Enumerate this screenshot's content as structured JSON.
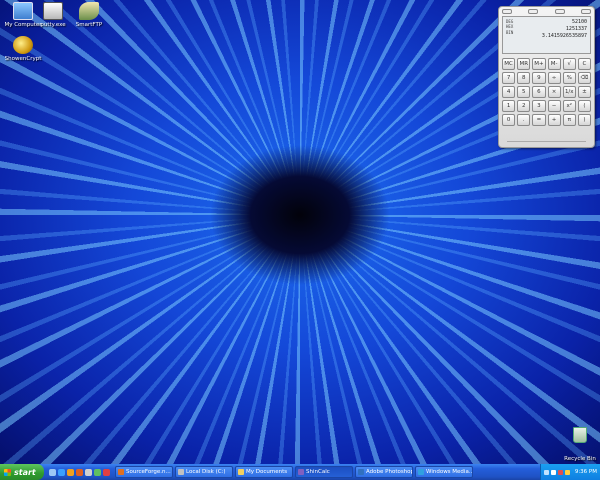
{
  "desktop": {
    "icons": [
      {
        "label": "My Computer",
        "icon": "computer-icon"
      },
      {
        "label": "putty.exe",
        "icon": "terminal-icon"
      },
      {
        "label": "SmartFTP",
        "icon": "ftp-icon"
      },
      {
        "label": "ShowenCrypt",
        "icon": "lock-icon"
      }
    ],
    "recycle_bin": {
      "label": "Recycle Bin",
      "icon": "recycle-bin-icon"
    }
  },
  "calculator": {
    "display_lines": [
      "52100",
      "1251337",
      "3.1415926535897"
    ],
    "mode_labels": [
      "DEG",
      "HEX",
      "BIN"
    ],
    "keys": [
      "MC",
      "MR",
      "M+",
      "M-",
      "√",
      "C",
      "7",
      "8",
      "9",
      "÷",
      "%",
      "⌫",
      "4",
      "5",
      "6",
      "×",
      "1/x",
      "±",
      "1",
      "2",
      "3",
      "−",
      "x²",
      "(",
      "0",
      ".",
      "=",
      "+",
      "π",
      ")"
    ]
  },
  "taskbar": {
    "start_label": "start",
    "tasks": [
      {
        "label": "SourceForge.n...",
        "color": "#e07020",
        "active": false
      },
      {
        "label": "Local Disk (C:)",
        "color": "#c0c0c0",
        "active": false
      },
      {
        "label": "My Documents",
        "color": "#f2d060",
        "active": false
      },
      {
        "label": "ShinCalc",
        "color": "#8060c0",
        "active": true
      },
      {
        "label": "Adobe Photoshop",
        "color": "#3070c0",
        "active": false
      },
      {
        "label": "Windows Media...",
        "color": "#30a0e0",
        "active": false
      }
    ],
    "clock": "9:36 PM"
  },
  "colors": {
    "taskbar": "#245edb",
    "start_button": "#2f9a2f",
    "wallpaper_core": "#05103a"
  }
}
